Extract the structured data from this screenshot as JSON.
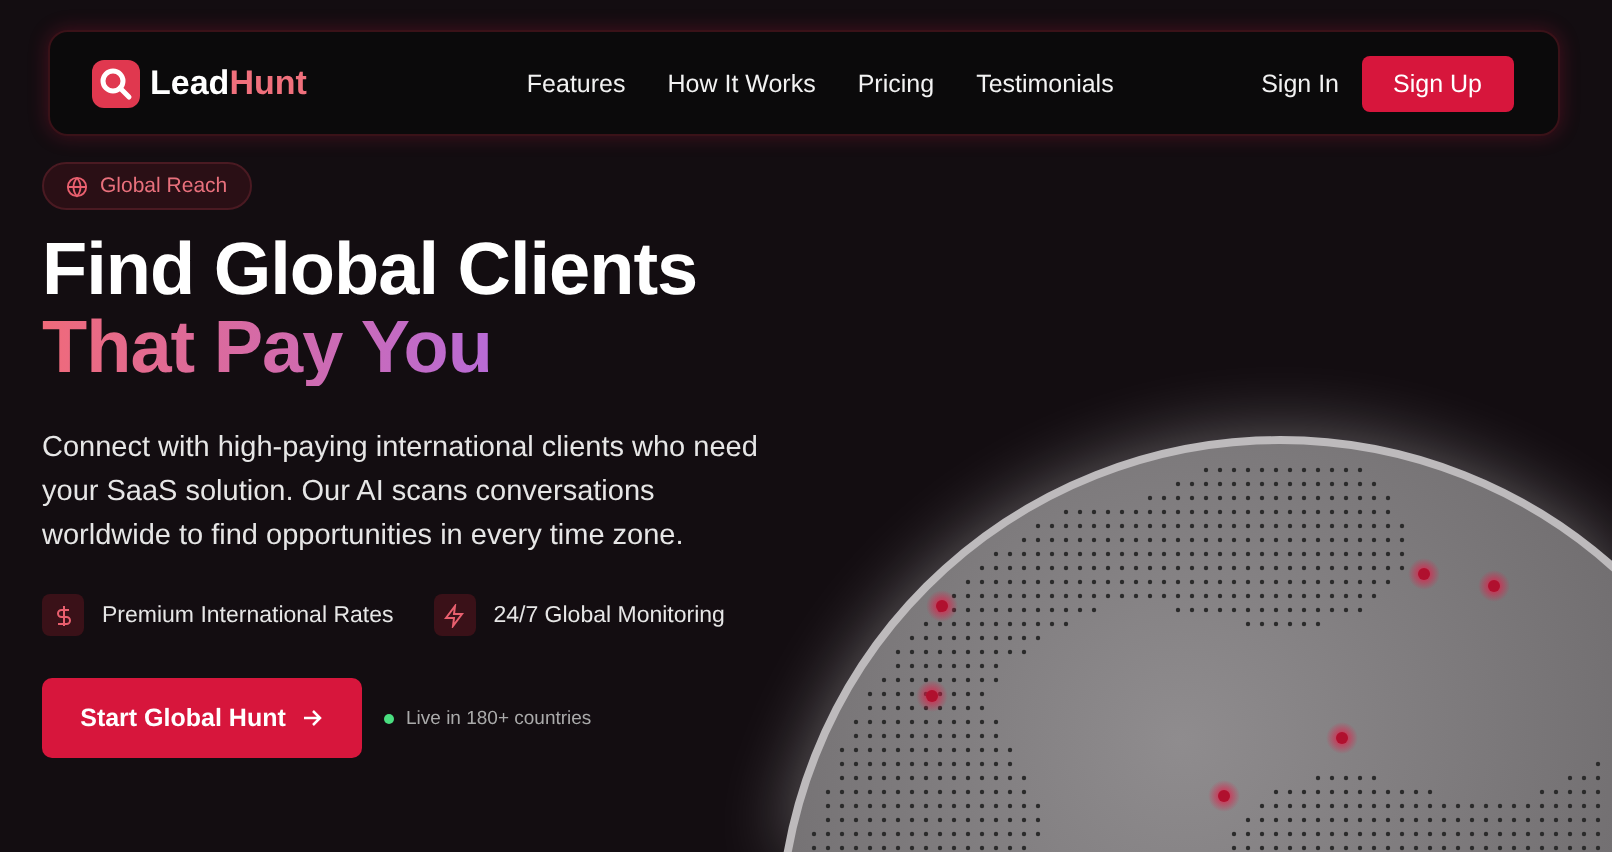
{
  "nav": {
    "logo": {
      "part_1": "Lead",
      "part_2": "Hunt"
    },
    "links": [
      "Features",
      "How It Works",
      "Pricing",
      "Testimonials"
    ],
    "sign_in": "Sign In",
    "sign_up": "Sign Up"
  },
  "hero": {
    "badge": "Global Reach",
    "title_line_1": "Find Global Clients",
    "title_line_2": "That Pay You",
    "description": "Connect with high-paying international clients who need your SaaS solution. Our AI scans conversations worldwide to find opportunities in every time zone.",
    "features": [
      {
        "kind": "dollar",
        "label": "Premium International Rates"
      },
      {
        "kind": "bolt",
        "label": "24/7 Global Monitoring"
      }
    ],
    "cta": "Start Global Hunt",
    "status": {
      "text": "Live in 180+ countries",
      "color": "#4ade80"
    }
  }
}
